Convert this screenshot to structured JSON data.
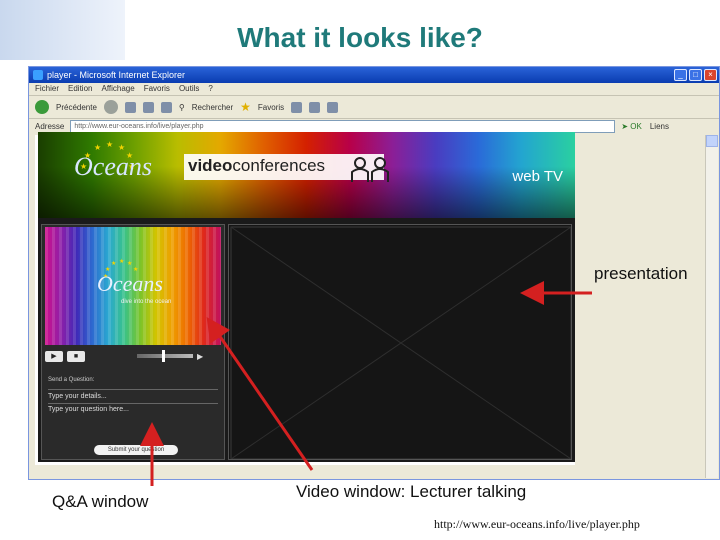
{
  "slide": {
    "title": "What it looks like?"
  },
  "browser": {
    "window_title": "player - Microsoft Internet Explorer",
    "menu": [
      "Fichier",
      "Edition",
      "Affichage",
      "Favoris",
      "Outils",
      "?"
    ],
    "toolbar": {
      "back_label": "Précédente",
      "search_label": "Rechercher",
      "favorites_label": "Favoris"
    },
    "address": {
      "label": "Adresse",
      "value": "http://www.eur-oceans.info/live/player.php",
      "go_label": "OK",
      "links_label": "Liens"
    },
    "window_buttons": [
      "_",
      "□",
      "×"
    ]
  },
  "player": {
    "logo_text": "Oceans",
    "banner_title_bold": "video",
    "banner_title_rest": "conferences",
    "web_tv_label": "web TV",
    "video_logo_text": "Oceans",
    "video_tagline": "dive into the ocean",
    "play_icon": "play-icon",
    "stop_icon": "stop-icon",
    "volume_level": 0.45,
    "qa": {
      "section_label": "Send a Question:",
      "name_placeholder": "Type your details...",
      "question_placeholder": "Type your question here...",
      "submit_label": "Submit your question"
    }
  },
  "annotations": {
    "presentation": "presentation",
    "qa_window": "Q&A window",
    "video_window": "Video window: Lecturer talking"
  },
  "source_url": "http://www.eur-oceans.info/live/player.php",
  "colors": {
    "title": "#1f7a7a",
    "arrow": "#d42020"
  }
}
